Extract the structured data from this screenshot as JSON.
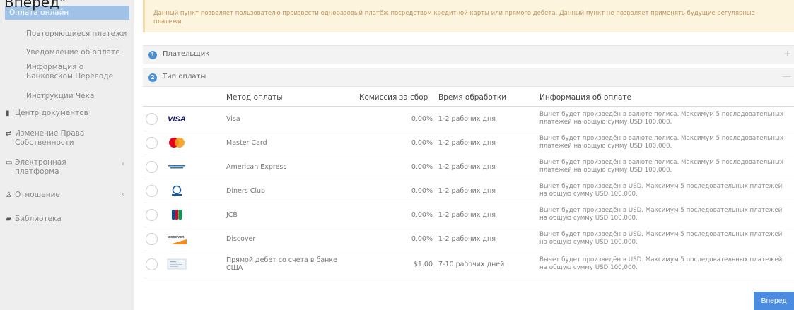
{
  "page": {
    "cut_title": "Вперёд\""
  },
  "sidebar": {
    "sub_items": [
      {
        "label": "Оплата онлайн",
        "active": true
      },
      {
        "label": "Повторяющиеся платежи"
      },
      {
        "label": "Уведомление об оплате"
      },
      {
        "label": "Информация о",
        "label2": "Банковском Переводе"
      },
      {
        "label": "Инструкции Чека"
      }
    ],
    "main_items": [
      {
        "label": "Центр документов",
        "icon": "document-icon"
      },
      {
        "label": "Изменение Права",
        "label2": "Собственности",
        "icon": "transfer-arrows-icon"
      },
      {
        "label": "Электронная",
        "label2": "платформа",
        "icon": "monitor-icon"
      },
      {
        "label": "Отношение",
        "icon": "people-icon"
      },
      {
        "label": "Библиотека",
        "icon": "book-icon"
      }
    ]
  },
  "notice": {
    "text": "Данный пункт позволяет пользователю произвести одноразовый платёж посредством кредитной карты или прямого дебета. Данный пункт не позволяет применять будущие регулярные платежи."
  },
  "panels": {
    "payer": {
      "num": "1",
      "title": "Плательщик",
      "toggle": "+"
    },
    "payment_type": {
      "num": "2",
      "title": "Тип оплаты",
      "toggle": "—"
    }
  },
  "table": {
    "headers": [
      "Метод оплаты",
      "Комиссия за сбор",
      "Время обработки",
      "Информация об оплате"
    ],
    "rows": [
      {
        "logo": "visa-logo",
        "method": "Visa",
        "fee": "0.00%",
        "time": "1-2 рабочих дня",
        "info": "Вычет будет произведён в валюте полиса. Максимум 5 последовательных платежей на общую сумму USD 100,000."
      },
      {
        "logo": "mastercard-logo",
        "method": "Master Card",
        "fee": "0.00%",
        "time": "1-2 рабочих дня",
        "info": "Вычет будет произведён в валюте полиса. Максимум 5 последовательных платежей на общую сумму USD 100,000."
      },
      {
        "logo": "amex-logo",
        "method": "American Express",
        "fee": "0.00%",
        "time": "1-2 рабочих дня",
        "info": "Вычет будет произведён в валюте полиса. Максимум 5 последовательных платежей на общую сумму USD 100,000."
      },
      {
        "logo": "diners-club-logo",
        "method": "Diners Club",
        "fee": "0.00%",
        "time": "1-2 рабочих дня",
        "info": "Вычет будет произведён в USD. Максимум 5 последовательных платежей на общую сумму USD 100,000."
      },
      {
        "logo": "jcb-logo",
        "method": "JCB",
        "fee": "0.00%",
        "time": "1-2 рабочих дня",
        "info": "Вычет будет произведён в USD. Максимум 5 последовательных платежей на общую сумму USD 100,000."
      },
      {
        "logo": "discover-logo",
        "method": "Discover",
        "fee": "0.00%",
        "time": "1-2 рабочих дня",
        "info": "Вычет будет произведён в USD. Максимум 5 последовательных платежей на общую сумму USD 100,000."
      },
      {
        "logo": "check-logo",
        "method": "Прямой дебет со счета в банке США",
        "fee": "$1.00",
        "time": "7-10 рабочих дней",
        "info": "Вычет будет произведён в USD. Максимум 5 последовательных платежей на общую сумму USD 100,000."
      }
    ]
  },
  "actions": {
    "next_label": "Вперед"
  },
  "colors": {
    "accent": "#4b8ce0",
    "sidebar_active": "#9fc2e6",
    "notice_bg": "#fdf4dd",
    "notice_text": "#b9935a"
  }
}
